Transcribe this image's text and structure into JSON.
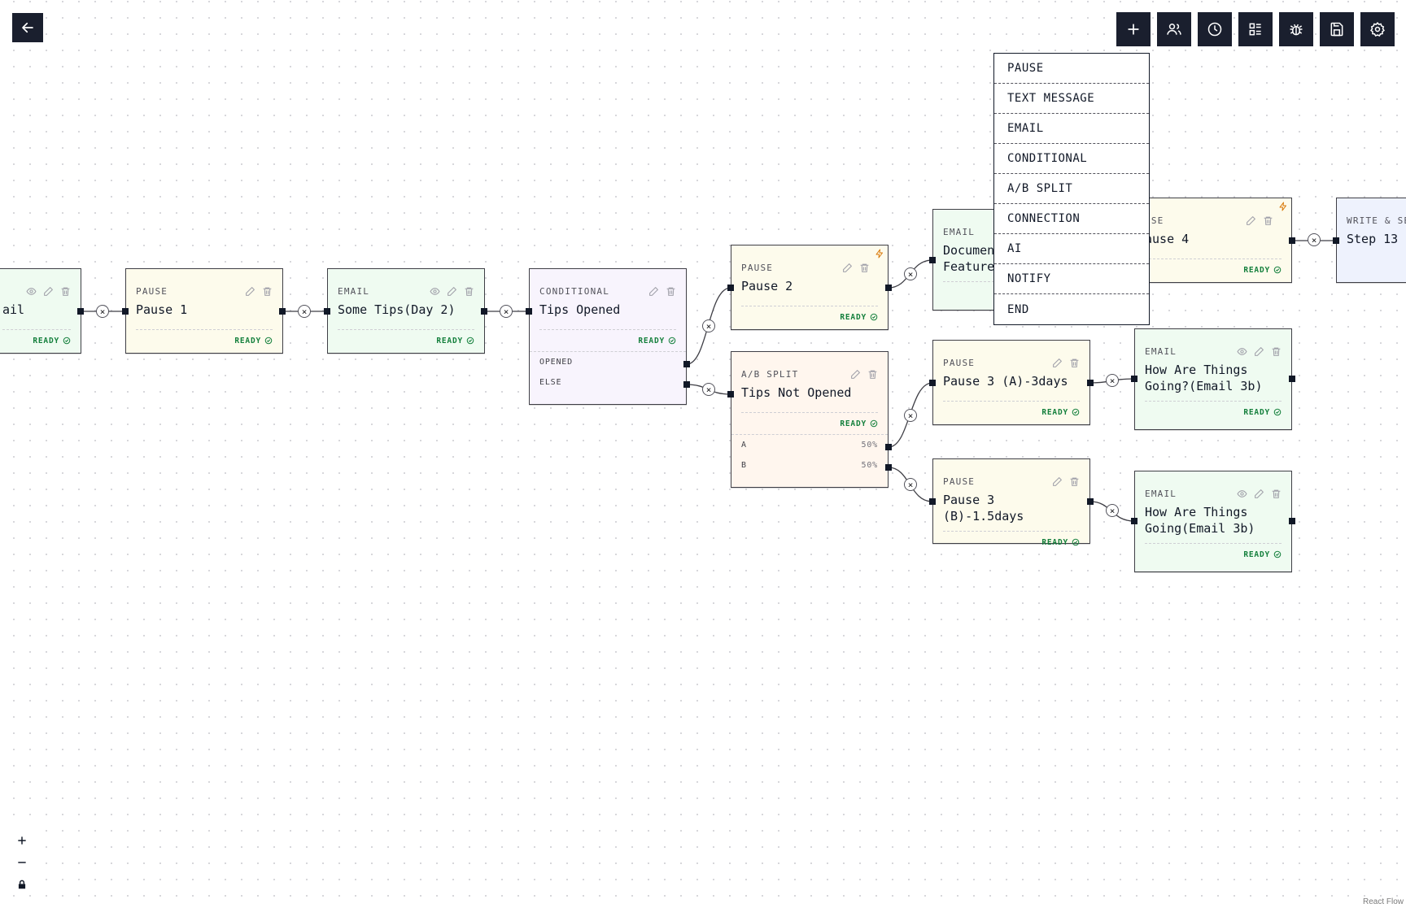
{
  "toolbar": {
    "back_icon": "arrow-left-icon",
    "buttons": [
      {
        "name": "add-step-button",
        "icon": "plus-icon"
      },
      {
        "name": "audience-button",
        "icon": "users-icon"
      },
      {
        "name": "schedule-button",
        "icon": "clock-icon"
      },
      {
        "name": "layout-button",
        "icon": "list-layout-icon"
      },
      {
        "name": "debug-button",
        "icon": "bug-icon"
      },
      {
        "name": "save-button",
        "icon": "floppy-disk-icon"
      },
      {
        "name": "settings-button",
        "icon": "gear-icon"
      }
    ]
  },
  "add_menu": {
    "items": [
      "PAUSE",
      "TEXT MESSAGE",
      "EMAIL",
      "CONDITIONAL",
      "A/B SPLIT",
      "CONNECTION",
      "AI",
      "NOTIFY",
      "END"
    ]
  },
  "nodes": {
    "email_left": {
      "type": "EMAIL",
      "title": "ail",
      "status": "READY"
    },
    "pause1": {
      "type": "PAUSE",
      "title": "Pause 1",
      "status": "READY"
    },
    "tips_day2": {
      "type": "EMAIL",
      "title": "Some Tips(Day 2)",
      "status": "READY"
    },
    "tips_opened": {
      "type": "CONDITIONAL",
      "title": "Tips Opened",
      "status": "READY",
      "branches": [
        "OPENED",
        "ELSE"
      ]
    },
    "pause2": {
      "type": "PAUSE",
      "title": "Pause 2",
      "status": "READY"
    },
    "tips_not_opened": {
      "type": "A/B SPLIT",
      "title": "Tips Not Opened",
      "status": "READY",
      "branches": [
        {
          "label": "A",
          "pct": "50%"
        },
        {
          "label": "B",
          "pct": "50%"
        }
      ]
    },
    "docs_features": {
      "type": "EMAIL",
      "title": "Document\nFeatures"
    },
    "pause4": {
      "type": "USE",
      "title": "ause 4",
      "status": "READY"
    },
    "step13": {
      "type": "WRITE & SEN",
      "title": "Step 13"
    },
    "pause3a": {
      "type": "PAUSE",
      "title": "Pause 3 (A)-3days",
      "status": "READY"
    },
    "pause3b": {
      "type": "PAUSE",
      "title": "Pause 3 (B)-1.5days",
      "status": "READY"
    },
    "how_things_a": {
      "type": "EMAIL",
      "title": "How Are Things\nGoing?(Email 3b)",
      "status": "READY"
    },
    "how_things_b": {
      "type": "EMAIL",
      "title": "How Are Things\nGoing(Email 3b)",
      "status": "READY"
    }
  },
  "edge_delete_label": "×",
  "zoom": {
    "in_icon": "plus-icon",
    "out_icon": "minus-icon",
    "lock_icon": "lock-icon"
  },
  "attribution": "React Flow"
}
